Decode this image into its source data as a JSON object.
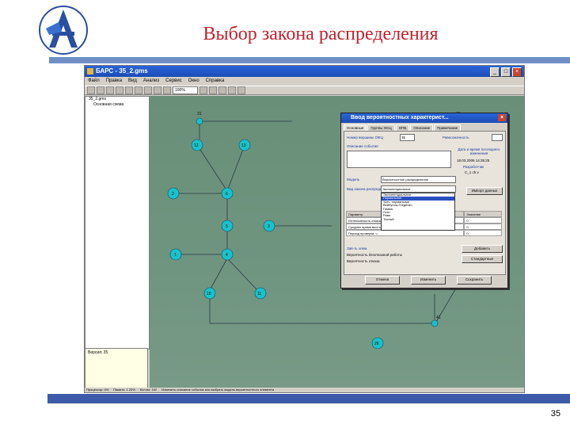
{
  "slide": {
    "title": "Выбор закона распределения",
    "page_number": "35"
  },
  "app": {
    "window_title": "БАРС - 35_2.gms",
    "menu": [
      "Файл",
      "Правка",
      "Вид",
      "Анализ",
      "Сервис",
      "Окно",
      "Справка"
    ],
    "zoom": "100%",
    "tree": {
      "root": "35_2.gms",
      "child": "Основная схема"
    },
    "version_panel": "Версия: 35",
    "status_items": [
      "Процессор: 4%",
      "Память: 1 20%",
      "Кол-во: 162",
      "Изменить описание события или выбрать модель вероятностного элемента"
    ]
  },
  "network": {
    "nodes": [
      {
        "id": "31",
        "label": "31"
      },
      {
        "id": "30",
        "label": "30"
      },
      {
        "id": "12",
        "label": "12"
      },
      {
        "id": "13",
        "label": "13"
      },
      {
        "id": "2",
        "label": "2"
      },
      {
        "id": "6",
        "label": "6"
      },
      {
        "id": "5",
        "label": "5"
      },
      {
        "id": "3",
        "label": "3"
      },
      {
        "id": "1",
        "label": "1"
      },
      {
        "id": "4",
        "label": "4"
      },
      {
        "id": "10",
        "label": "10"
      },
      {
        "id": "11",
        "label": "11"
      },
      {
        "id": "26",
        "label": "26"
      },
      {
        "id": "14",
        "label": "14"
      },
      {
        "id": "25",
        "label": "25"
      },
      {
        "id": "41",
        "label": "41"
      }
    ]
  },
  "dialog": {
    "title": "Ввод вероятностных характерист...",
    "tabs": [
      "Основные",
      "Группы ОСЦ",
      "ОПБ",
      "Описание",
      "Примечание"
    ],
    "vertex_number_label": "Номер вершины ОФЦ",
    "vertex_number_value": "35",
    "equivalence_label": "Равнозначность",
    "event_description_label": "Описание события",
    "date_label": "Дата и время последнего изменения",
    "date_value": "18.03.2006 14:35:25",
    "developer_label": "Разработчик",
    "developer_value": "C_1 ch.v",
    "model_label": "Модель",
    "model_value": "Вероятностное распределение",
    "law_label": "Вид закона распределения",
    "law_value": "Экспоненциальное",
    "distribution_options": [
      "Экспоненциальное",
      "Нормальное",
      "Усеч. нормальное",
      "Вейбулла-Гнеденко",
      "Гамма",
      "Логн.",
      "Равн.",
      "Точный"
    ],
    "selected_option_index": 1,
    "import_button": "Импорт данных",
    "table_headers": [
      "Параметр",
      "Значение"
    ],
    "table_rows": [
      {
        "param": "Интенсивность отказов",
        "value": "0"
      },
      {
        "param": "Среднее время восстановления, ч",
        "value": "0"
      },
      {
        "param": "Период проверки, ч",
        "value": "0"
      }
    ],
    "dependency_label": "Зав-ть элем.",
    "element_prob_label": "Вероятность безотказной работы",
    "element_prob2_label": "Вероятность отказа",
    "add_button": "Добавить",
    "edit_button": "Стандартные",
    "cancel_button": "Отмена",
    "change_button": "Изменить",
    "save_button": "Сохранить"
  }
}
